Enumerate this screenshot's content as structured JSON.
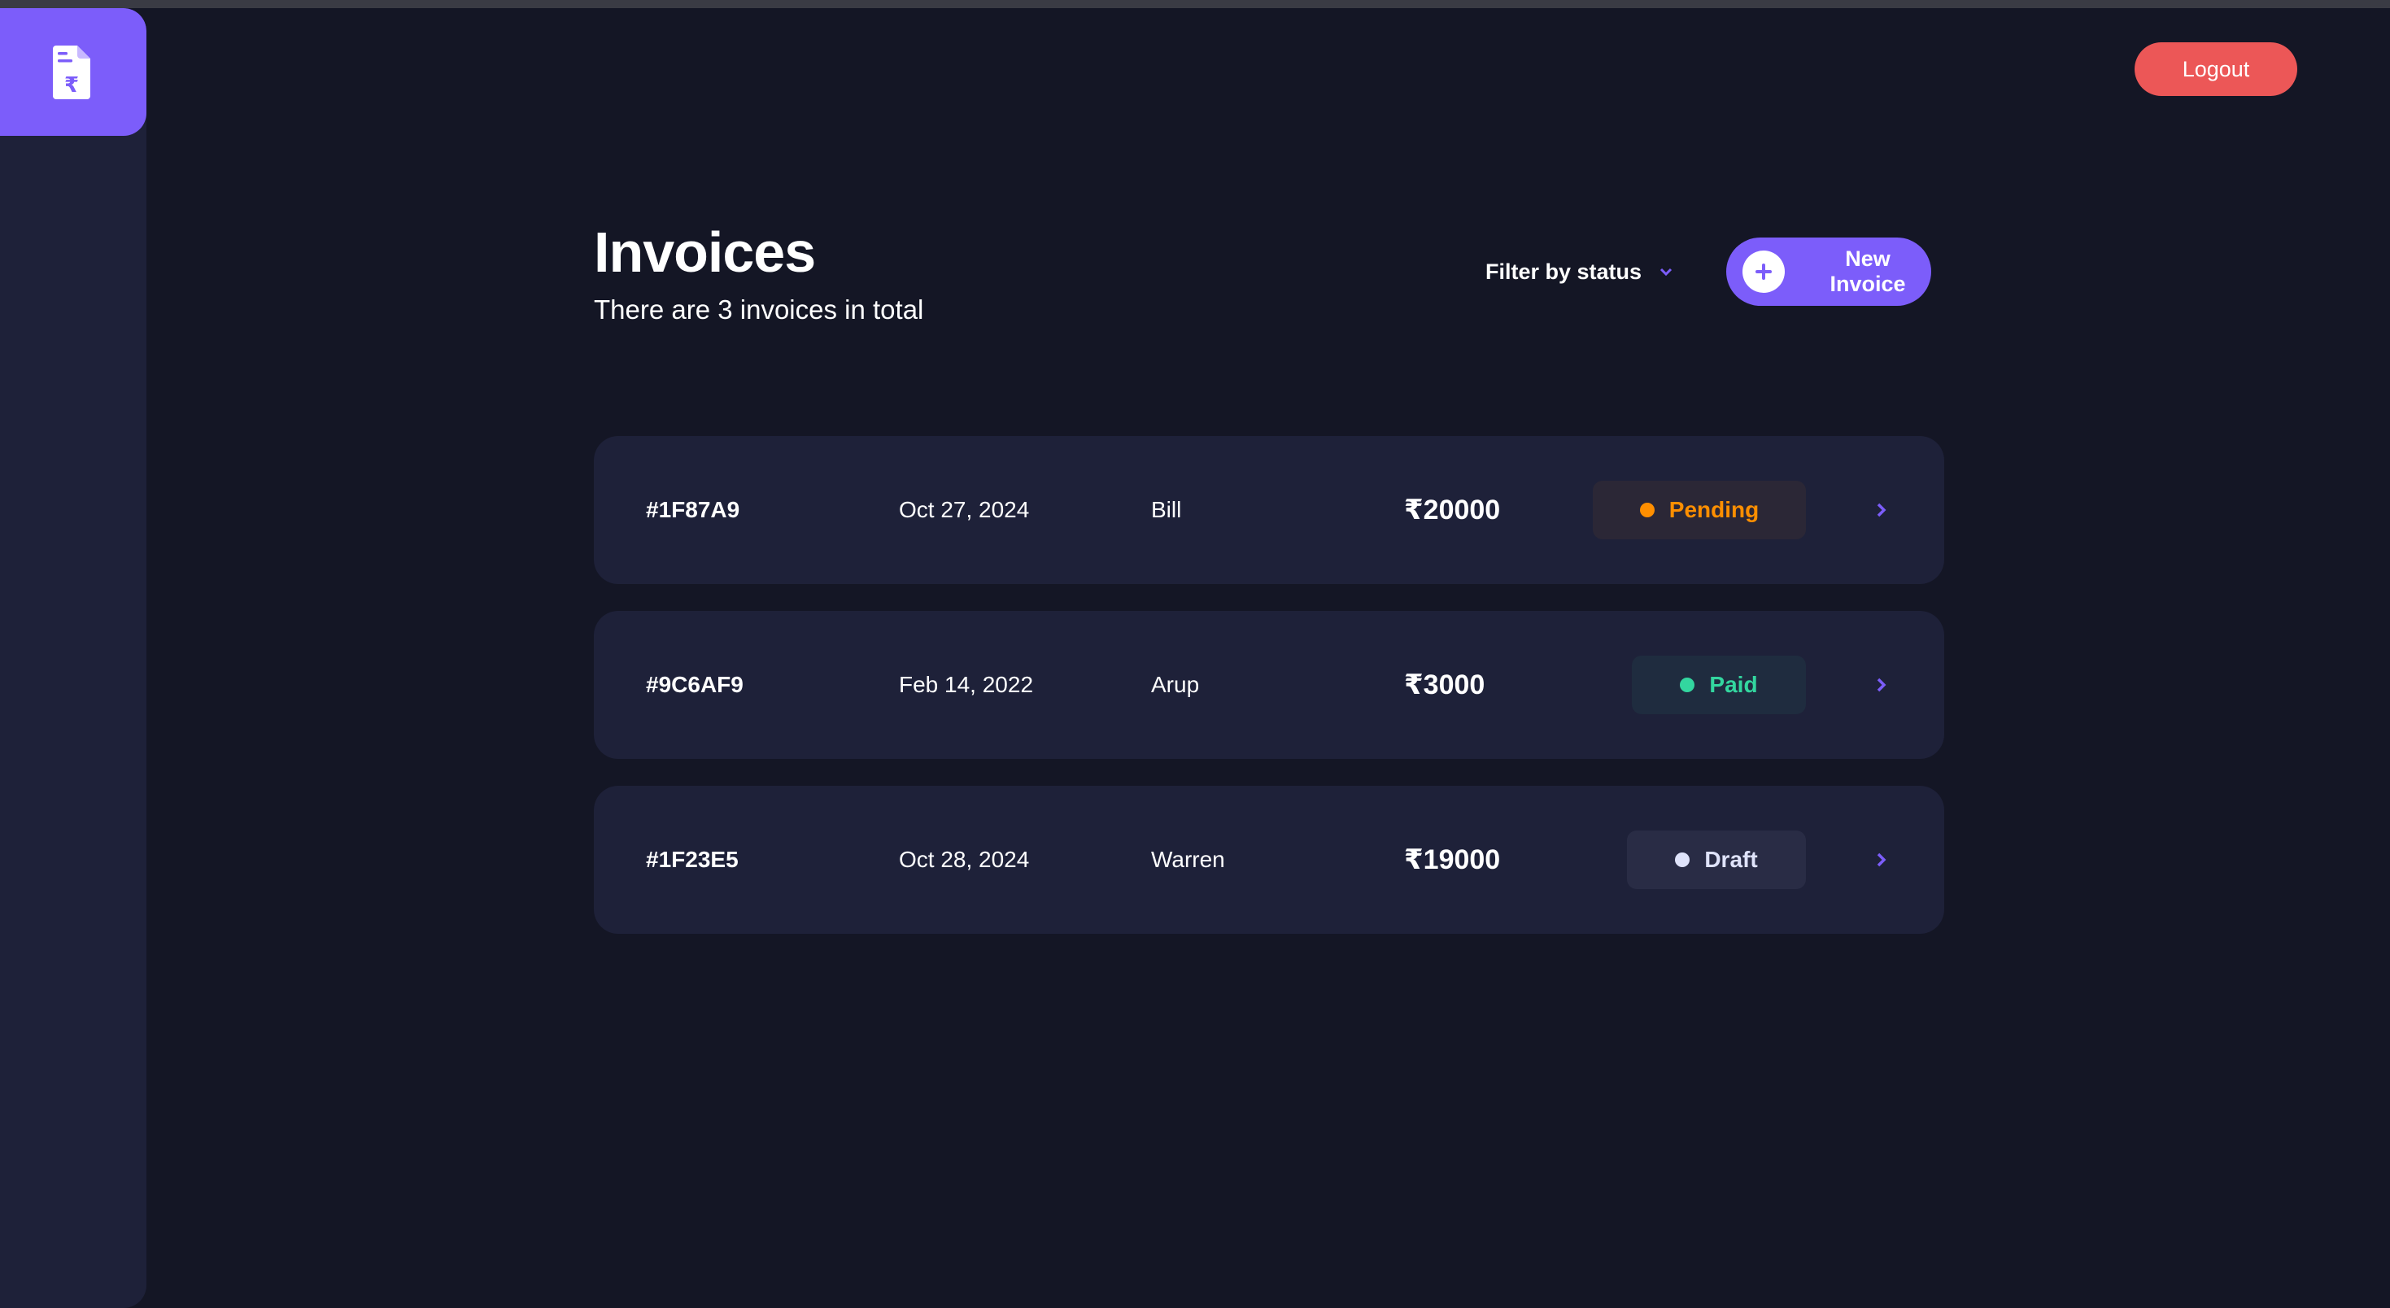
{
  "app": {
    "logo_icon": "invoice-rupee-icon",
    "logout_label": "Logout"
  },
  "header": {
    "title": "Invoices",
    "subtitle": "There are 3 invoices in total",
    "filter_label": "Filter by status",
    "new_invoice_label": "New Invoice"
  },
  "colors": {
    "accent": "#7c5dfa",
    "logout": "#ec5757",
    "pending": "#ff8f00",
    "paid": "#33d69f",
    "draft": "#dfe3fa"
  },
  "invoices": [
    {
      "id": "#1F87A9",
      "date": "Oct 27, 2024",
      "client": "Bill",
      "amount": "₹20000",
      "status": "Pending"
    },
    {
      "id": "#9C6AF9",
      "date": "Feb 14, 2022",
      "client": "Arup",
      "amount": "₹3000",
      "status": "Paid"
    },
    {
      "id": "#1F23E5",
      "date": "Oct 28, 2024",
      "client": "Warren",
      "amount": "₹19000",
      "status": "Draft"
    }
  ]
}
